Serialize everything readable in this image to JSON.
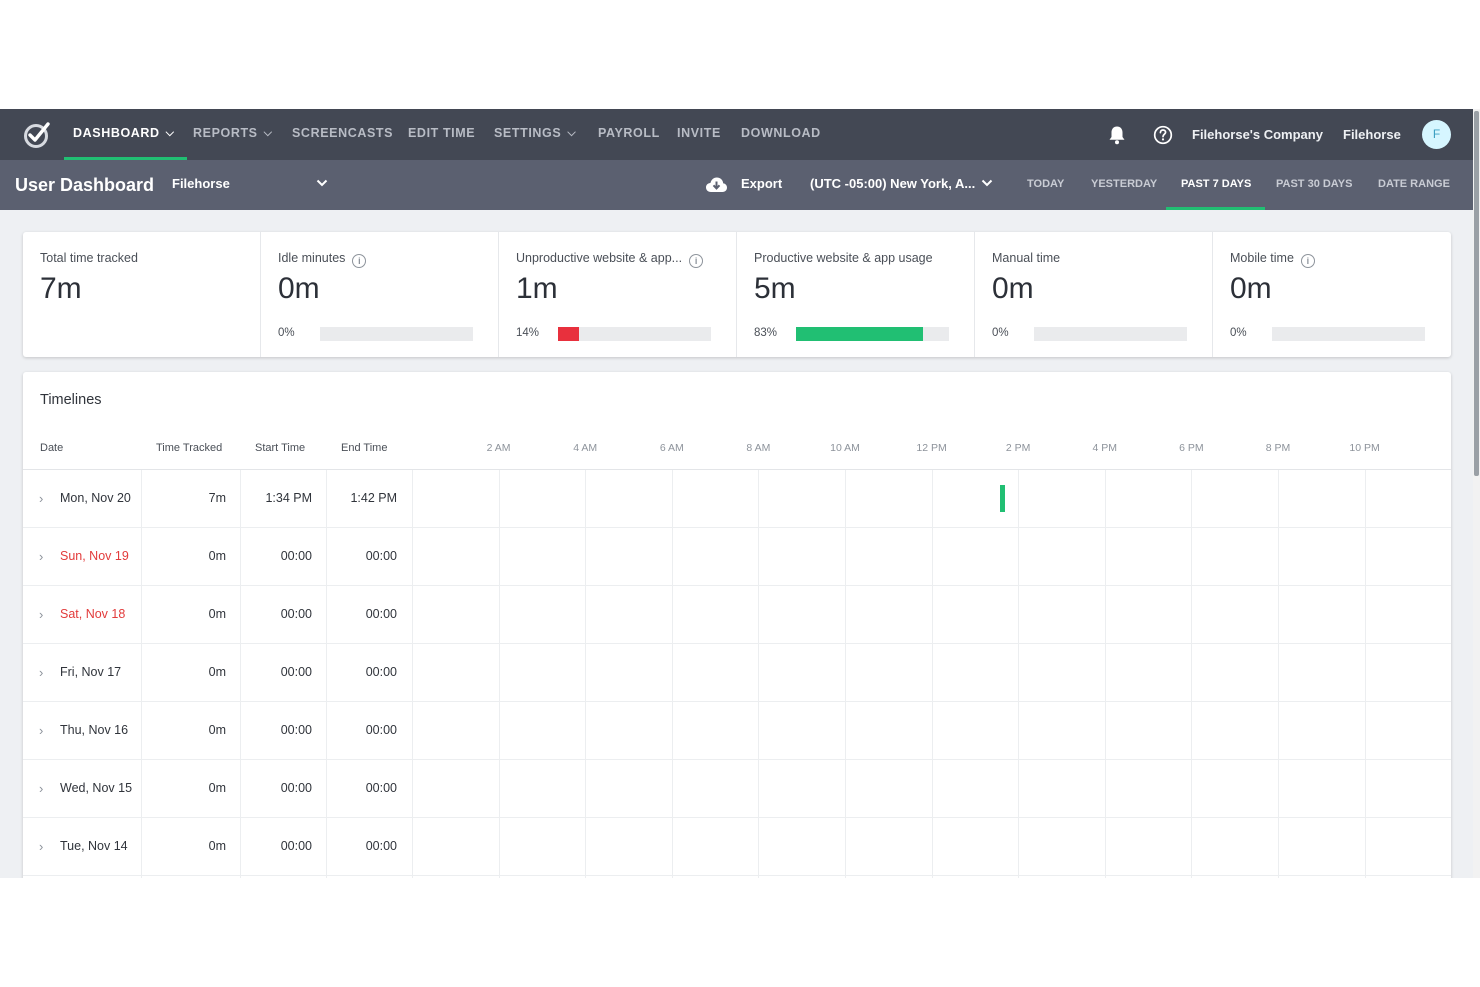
{
  "nav": {
    "items": [
      {
        "label": "DASHBOARD",
        "dropdown": true,
        "active": true
      },
      {
        "label": "REPORTS",
        "dropdown": true
      },
      {
        "label": "SCREENCASTS"
      },
      {
        "label": "EDIT TIME"
      },
      {
        "label": "SETTINGS",
        "dropdown": true
      },
      {
        "label": "PAYROLL"
      },
      {
        "label": "INVITE"
      },
      {
        "label": "DOWNLOAD"
      }
    ],
    "company": "Filehorse's Company",
    "username": "Filehorse",
    "avatar_letter": "F",
    "icons": [
      "logo-check-icon",
      "bell-icon",
      "help-icon"
    ]
  },
  "subheader": {
    "title": "User Dashboard",
    "user_selected": "Filehorse",
    "export_label": "Export",
    "timezone": "(UTC -05:00) New York, A...",
    "ranges": [
      "TODAY",
      "YESTERDAY",
      "PAST 7 DAYS",
      "PAST 30 DAYS",
      "DATE RANGE"
    ],
    "active_range": "PAST 7 DAYS"
  },
  "stats": [
    {
      "label": "Total time tracked",
      "value": "7m",
      "info": false
    },
    {
      "label": "Idle minutes",
      "value": "0m",
      "info": true,
      "percent": "0%",
      "fill": 0,
      "color": "#eaebed"
    },
    {
      "label": "Unproductive website & app...",
      "value": "1m",
      "info": true,
      "percent": "14%",
      "fill": 0.14,
      "color": "#e8303d"
    },
    {
      "label": "Productive website & app usage",
      "value": "5m",
      "info": false,
      "percent": "83%",
      "fill": 0.83,
      "color": "#21bf73"
    },
    {
      "label": "Manual time",
      "value": "0m",
      "info": false,
      "percent": "0%",
      "fill": 0,
      "color": "#eaebed"
    },
    {
      "label": "Mobile time",
      "value": "0m",
      "info": true,
      "percent": "0%",
      "fill": 0,
      "color": "#eaebed"
    }
  ],
  "timelines": {
    "title": "Timelines",
    "columns": [
      "Date",
      "Time Tracked",
      "Start Time",
      "End Time"
    ],
    "hours": [
      "2 AM",
      "4 AM",
      "6 AM",
      "8 AM",
      "10 AM",
      "12 PM",
      "2 PM",
      "4 PM",
      "6 PM",
      "8 PM",
      "10 PM"
    ],
    "rows": [
      {
        "date": "Mon, Nov 20",
        "tracked": "7m",
        "start": "1:34 PM",
        "end": "1:42 PM",
        "weekend": false,
        "activity_start_hour": 13.57,
        "activity_end_hour": 13.7
      },
      {
        "date": "Sun, Nov 19",
        "tracked": "0m",
        "start": "00:00",
        "end": "00:00",
        "weekend": true
      },
      {
        "date": "Sat, Nov 18",
        "tracked": "0m",
        "start": "00:00",
        "end": "00:00",
        "weekend": true
      },
      {
        "date": "Fri, Nov 17",
        "tracked": "0m",
        "start": "00:00",
        "end": "00:00",
        "weekend": false
      },
      {
        "date": "Thu, Nov 16",
        "tracked": "0m",
        "start": "00:00",
        "end": "00:00",
        "weekend": false
      },
      {
        "date": "Wed, Nov 15",
        "tracked": "0m",
        "start": "00:00",
        "end": "00:00",
        "weekend": false
      },
      {
        "date": "Tue, Nov 14",
        "tracked": "0m",
        "start": "00:00",
        "end": "00:00",
        "weekend": false
      },
      {
        "date": "",
        "tracked": "",
        "start": "",
        "end": "",
        "weekend": false
      }
    ]
  },
  "colors": {
    "nav_bg": "#434854",
    "subbar_bg": "#5b6070",
    "accent": "#21bf73",
    "weekend": "#e23b3b"
  }
}
